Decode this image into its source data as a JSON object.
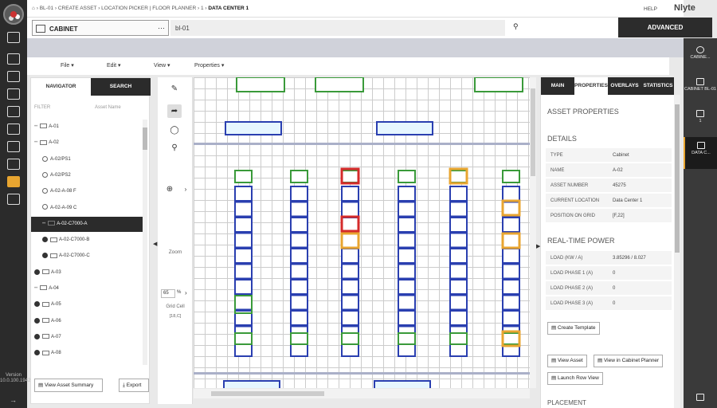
{
  "topbar": {
    "crumbs": [
      "BL-01",
      "CREATE ASSET",
      "LOCATION PICKER",
      "FLOOR PLANNER",
      "1"
    ],
    "current": "DATA CENTER 1",
    "help": "HELP",
    "brand": "Nlyte"
  },
  "search": {
    "type_label": "CABINET",
    "query": "bl-01",
    "advanced": "ADVANCED"
  },
  "right_rail": [
    {
      "label": "CABINET BL-01"
    },
    {
      "label": "1"
    },
    {
      "label": "DATA C..."
    }
  ],
  "rail_search": "CABINE...",
  "version": "Version 10.0.100.19423",
  "menu": [
    "File",
    "Edit",
    "View",
    "Properties"
  ],
  "navigator": {
    "tabs": [
      "NAVIGATOR",
      "SEARCH"
    ],
    "filter": "FILTER",
    "asset_name": "Asset Name",
    "items": [
      {
        "label": "A-01",
        "kind": "cab",
        "indent": 0
      },
      {
        "label": "A-02",
        "kind": "cab",
        "indent": 0
      },
      {
        "label": "A-02/PS1",
        "kind": "circle",
        "indent": 1
      },
      {
        "label": "A-02/PS2",
        "kind": "circle",
        "indent": 1
      },
      {
        "label": "A-02-A-08 F",
        "kind": "circle",
        "indent": 1
      },
      {
        "label": "A-02-A-09 C",
        "kind": "circle",
        "indent": 1
      },
      {
        "label": "A-02-C7000-A",
        "kind": "cab",
        "indent": 1,
        "selected": true
      },
      {
        "label": "A-02-C7000-B",
        "kind": "arrow",
        "indent": 1
      },
      {
        "label": "A-02-C7000-C",
        "kind": "arrow",
        "indent": 1
      },
      {
        "label": "A-03",
        "kind": "arrow",
        "indent": 0
      },
      {
        "label": "A-04",
        "kind": "cab",
        "indent": 0
      },
      {
        "label": "A-05",
        "kind": "arrow",
        "indent": 0
      },
      {
        "label": "A-06",
        "kind": "arrow",
        "indent": 0
      },
      {
        "label": "A-07",
        "kind": "arrow",
        "indent": 0
      },
      {
        "label": "A-08",
        "kind": "arrow",
        "indent": 0
      }
    ],
    "summary_btn": "View Asset Summary",
    "export_btn": "Export"
  },
  "tools": {
    "zoom": "Zoom",
    "zoom_pct": "65",
    "pct_sign": "%",
    "grid_cell": "Grid Cell",
    "grid_value": "[18,C]"
  },
  "props": {
    "tabs": [
      "MAIN",
      "PROPERTIES",
      "OVERLAYS",
      "STATISTICS"
    ],
    "title": "ASSET PROPERTIES",
    "details_title": "DETAILS",
    "details": [
      {
        "k": "TYPE",
        "v": "Cabinet"
      },
      {
        "k": "NAME",
        "v": "A-02"
      },
      {
        "k": "ASSET NUMBER",
        "v": "45275"
      },
      {
        "k": "CURRENT LOCATION",
        "v": "Data Center 1"
      },
      {
        "k": "POSITION ON GRID",
        "v": "[F,22]"
      }
    ],
    "power_title": "REAL-TIME POWER",
    "power": [
      {
        "k": "LOAD (KW / A)",
        "v": "3.85296 / 8.027"
      },
      {
        "k": "LOAD PHASE 1 (A)",
        "v": "0"
      },
      {
        "k": "LOAD PHASE 2 (A)",
        "v": "0"
      },
      {
        "k": "LOAD PHASE 3 (A)",
        "v": "0"
      }
    ],
    "create_template": "Create Template",
    "view_asset": "View Asset",
    "view_cabinet": "View in Cabinet Planner",
    "launch_row": "Launch Row View",
    "placement": "PLACEMENT"
  },
  "colors": {
    "rack_blue": "#2a3fb0",
    "green": "#3a9a3a",
    "red": "#d42a2a",
    "orange": "#e8a530",
    "dark": "#2b2b2b"
  }
}
